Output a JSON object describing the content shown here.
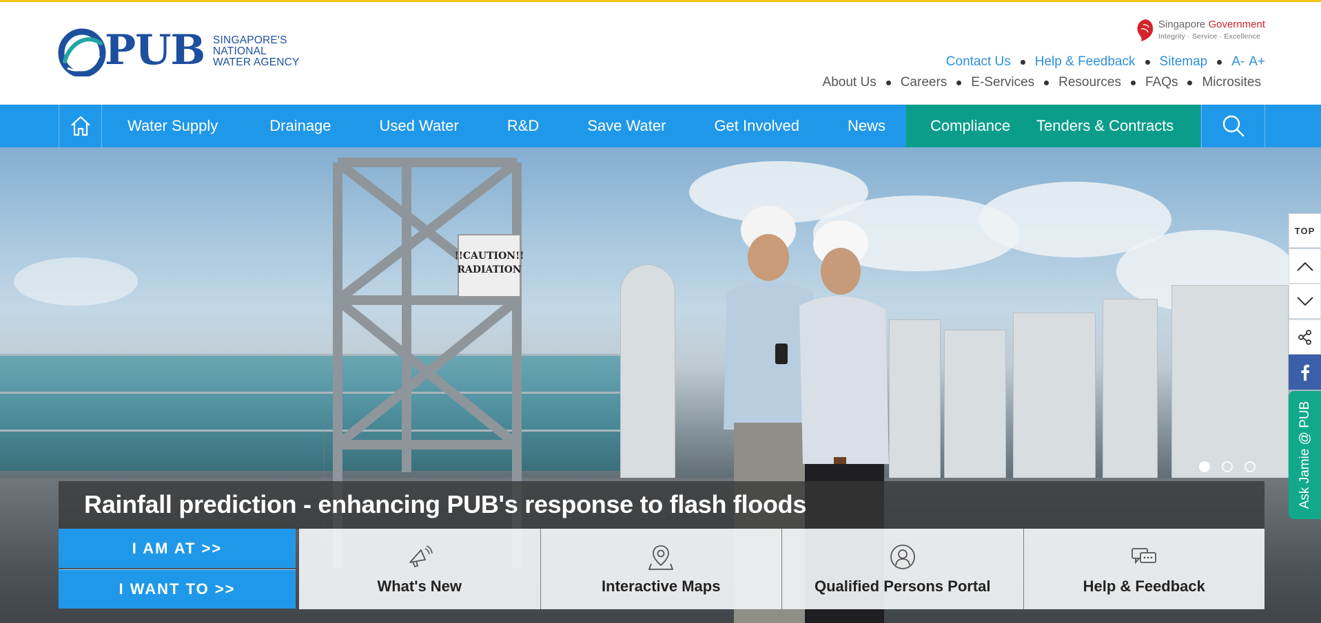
{
  "header": {
    "logo": {
      "mark": "PUB",
      "tagline": [
        "SINGAPORE'S",
        "NATIONAL",
        "WATER AGENCY"
      ]
    },
    "sg_gov": {
      "title_part1": "Singapore",
      "title_part2": "Government",
      "tagline": "Integrity · Service · Excellence"
    },
    "utility_links": {
      "contact": "Contact Us",
      "help": "Help & Feedback",
      "sitemap": "Sitemap",
      "font_decrease": "A-",
      "font_increase": "A+"
    },
    "secondary_links": {
      "about": "About Us",
      "careers": "Careers",
      "eservices": "E-Services",
      "resources": "Resources",
      "faqs": "FAQs",
      "microsites": "Microsites"
    }
  },
  "nav": {
    "home_icon": "home-icon",
    "items": [
      "Water Supply",
      "Drainage",
      "Used Water",
      "R&D",
      "Save Water",
      "Get Involved",
      "News"
    ],
    "highlight_items": [
      "Compliance",
      "Tenders & Contracts"
    ],
    "highlight_color": "#0a9e8a",
    "bar_color": "#2098e9",
    "search_icon": "search-icon"
  },
  "hero": {
    "caption": "Rainfall prediction - enhancing PUB's response to flash floods",
    "slides_total": 3,
    "active_slide": 1,
    "sign_text": "!!CAUTION!! RADIATION"
  },
  "actions": {
    "i_am_at": "I AM AT >>",
    "i_want_to": "I WANT TO >>"
  },
  "quick_links": [
    {
      "label": "What's New",
      "icon": "megaphone-icon"
    },
    {
      "label": "Interactive Maps",
      "icon": "map-pin-icon"
    },
    {
      "label": "Qualified Persons Portal",
      "icon": "user-icon"
    },
    {
      "label": "Help & Feedback",
      "icon": "chat-icon"
    }
  ],
  "side_tools": {
    "top_label": "TOP",
    "ask": "Ask Jamie @ PUB"
  }
}
